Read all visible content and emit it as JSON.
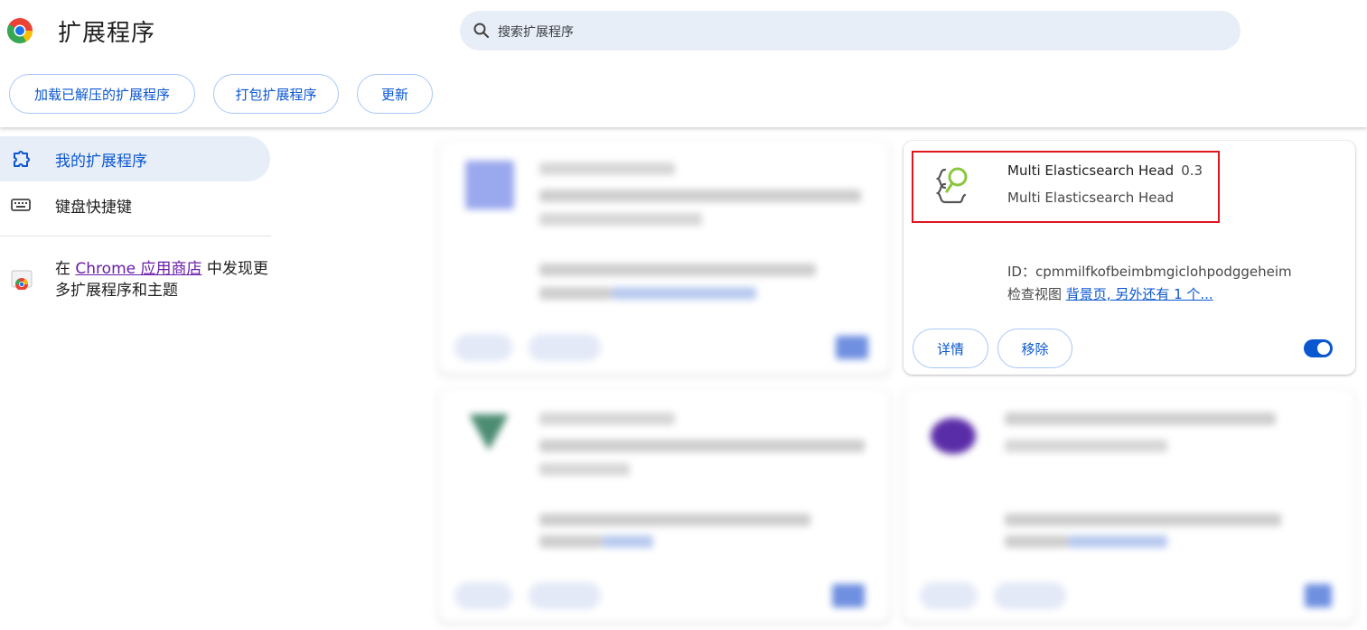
{
  "header": {
    "title": "扩展程序",
    "search_placeholder": "搜索扩展程序",
    "buttons": {
      "load_unpacked": "加载已解压的扩展程序",
      "pack": "打包扩展程序",
      "update": "更新"
    }
  },
  "sidebar": {
    "items": [
      {
        "label": "我的扩展程序",
        "icon": "extension-icon",
        "active": true
      },
      {
        "label": "键盘快捷键",
        "icon": "keyboard-icon",
        "active": false
      }
    ],
    "store_prefix": "在 ",
    "store_link": "Chrome 应用商店",
    "store_suffix": " 中发现更多扩展程序和主题"
  },
  "extension": {
    "name": "Multi Elasticsearch Head",
    "version": "0.3",
    "description": "Multi Elasticsearch Head",
    "id_label": "ID：",
    "id": "cpmmilfkofbeimbmgiclohpodggeheim",
    "view_label": "检查视图 ",
    "view_link": "背景页, 另外还有 1 个...",
    "details_button": "详情",
    "remove_button": "移除",
    "enabled": true
  },
  "colors": {
    "accent": "#0b57d0",
    "highlight_box": "#e0161e",
    "search_bg": "#e8eef7",
    "active_nav_bg": "#e8eef8"
  }
}
